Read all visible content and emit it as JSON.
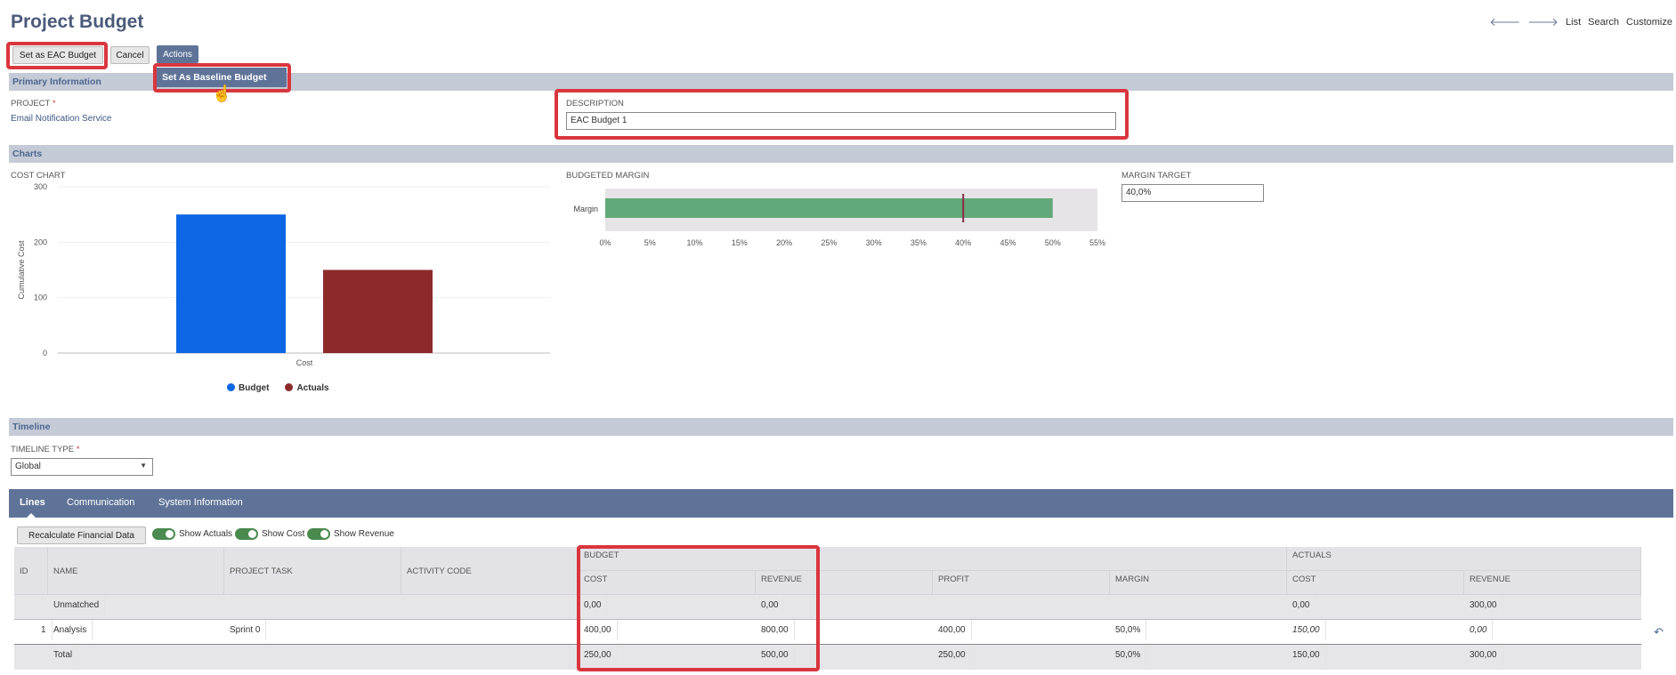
{
  "header": {
    "title": "Project Budget",
    "nav": {
      "list": "List",
      "search": "Search",
      "customize": "Customize"
    }
  },
  "toolbar": {
    "set_eac": "Set as EAC Budget",
    "cancel": "Cancel",
    "actions": "Actions",
    "dropdown_item": "Set As Baseline Budget"
  },
  "primary": {
    "section": "Primary Information",
    "project_label": "PROJECT",
    "required_mark": "*",
    "project_value": "Email Notification Service",
    "description_label": "DESCRIPTION",
    "description_value": "EAC Budget 1"
  },
  "charts": {
    "section": "Charts",
    "cost_chart_label": "COST CHART",
    "budgeted_margin_label": "BUDGETED MARGIN",
    "margin_target_label": "MARGIN TARGET",
    "margin_target_value": "40,0%",
    "legend": [
      {
        "name": "Budget",
        "color": "#0d66e5"
      },
      {
        "name": "Actuals",
        "color": "#8c2a2a"
      }
    ]
  },
  "chart_data": [
    {
      "type": "bar",
      "categories": [
        "Cost"
      ],
      "series": [
        {
          "name": "Budget",
          "values": [
            250
          ]
        },
        {
          "name": "Actuals",
          "values": [
            150
          ]
        }
      ],
      "ylabel": "Cumulative Cost",
      "yticks": [
        "0",
        "100",
        "200",
        "300"
      ],
      "ylim": [
        0,
        300
      ]
    },
    {
      "type": "bar",
      "orientation": "horizontal",
      "categories": [
        "Margin"
      ],
      "values": [
        50
      ],
      "target": 40,
      "xticks": [
        "0%",
        "5%",
        "10%",
        "15%",
        "20%",
        "25%",
        "30%",
        "35%",
        "40%",
        "45%",
        "50%",
        "55%"
      ],
      "xlim": [
        0,
        55
      ],
      "color": "#62a87a"
    }
  ],
  "timeline": {
    "section": "Timeline",
    "type_label": "TIMELINE TYPE",
    "type_value": "Global"
  },
  "tabs": [
    "Lines",
    "Communication",
    "System Information"
  ],
  "lines": {
    "recalc": "Recalculate Financial Data",
    "toggles": [
      "Show Actuals",
      "Show Cost",
      "Show Revenue"
    ],
    "headers": {
      "id": "ID",
      "name": "NAME",
      "task": "PROJECT TASK",
      "activity": "ACTIVITY CODE",
      "budget": "BUDGET",
      "actuals": "ACTUALS",
      "cost": "COST",
      "revenue": "REVENUE",
      "profit": "PROFIT",
      "margin": "MARGIN",
      "a_cost": "COST",
      "a_revenue": "REVENUE"
    },
    "rows": [
      {
        "id": "",
        "name": "Unmatched",
        "task": "",
        "activity": "",
        "cost": "0,00",
        "revenue": "0,00",
        "profit": "",
        "margin": "",
        "a_cost": "0,00",
        "a_revenue": "300,00"
      },
      {
        "id": "1",
        "name": "Analysis",
        "task": "Sprint 0",
        "activity": "",
        "cost": "400,00",
        "revenue": "800,00",
        "profit": "400,00",
        "margin": "50,0%",
        "a_cost": "150,00",
        "a_revenue": "0,00"
      },
      {
        "id": "",
        "name": "Total",
        "task": "",
        "activity": "",
        "cost": "250,00",
        "revenue": "500,00",
        "profit": "250,00",
        "margin": "50,0%",
        "a_cost": "150,00",
        "a_revenue": "300,00"
      }
    ]
  }
}
